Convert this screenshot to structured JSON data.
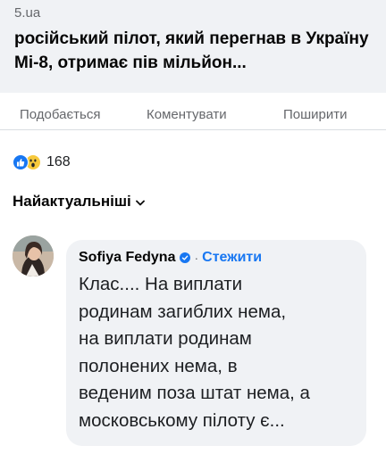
{
  "post": {
    "link_preview": {
      "domain": "5.ua",
      "title": "російський пілот, який перегнав в Україну Мі-8, отримає пів мільйон..."
    },
    "actions": {
      "like_label": "Подобається",
      "comment_label": "Коментувати",
      "share_label": "Поширити"
    },
    "reactions": {
      "icons": [
        "like-icon",
        "wow-icon"
      ],
      "count": "168"
    }
  },
  "comments": {
    "sort_label": "Найактуальніші",
    "items": [
      {
        "author": "Sofiya Fedyna",
        "separator": "·",
        "follow_label": "Стежити",
        "text": "Клас.... На виплати\nродинам загиблих нема,\nна виплати родинам\nполонених нема, в\nведеним поза штат нема, а\nмосковському пілоту є..."
      }
    ]
  },
  "colors": {
    "accent": "#1877f2",
    "muted_text": "#65676b",
    "card_background": "#f0f2f5"
  }
}
